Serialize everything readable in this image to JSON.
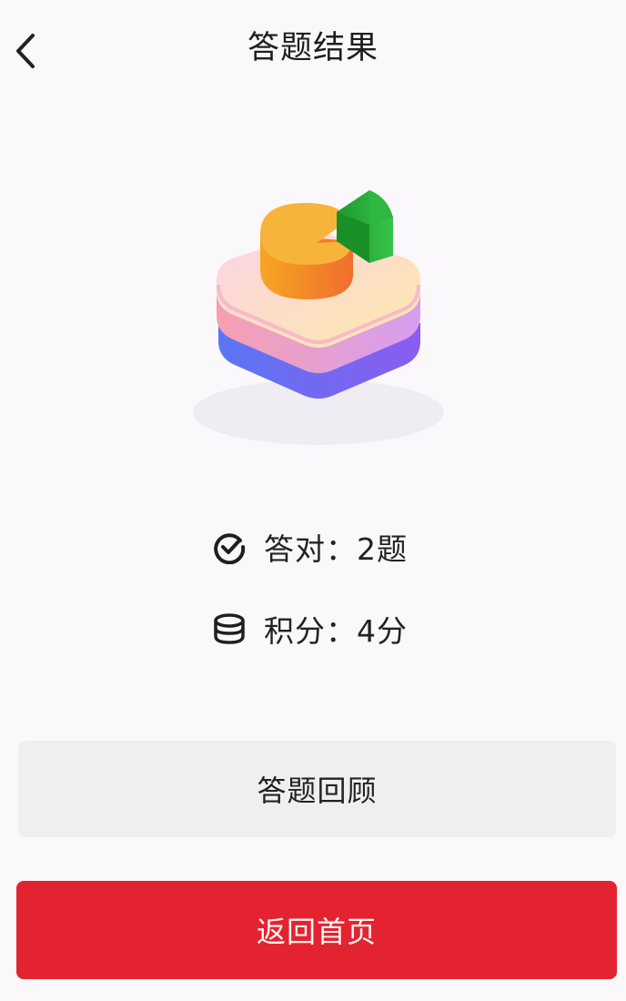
{
  "header": {
    "back_icon": "chevron-left-icon",
    "title": "答题结果"
  },
  "illustration": {
    "icon": "pie-chart-illustration"
  },
  "stats": {
    "correct": {
      "icon": "check-circle-icon",
      "text": "答对：2题"
    },
    "score": {
      "icon": "coins-icon",
      "text": "积分：4分"
    }
  },
  "buttons": {
    "review_label": "答题回顾",
    "home_label": "返回首页"
  },
  "colors": {
    "background": "#fbf8fb",
    "primary_red": "#e42330",
    "secondary_button": "#f1eef1",
    "text": "#1f1f1f"
  }
}
